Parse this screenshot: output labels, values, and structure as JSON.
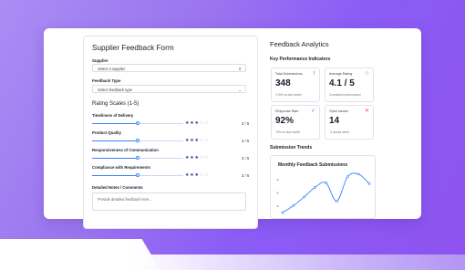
{
  "form": {
    "title": "Supplier Feedback Form",
    "supplier_label": "Supplier",
    "supplier_placeholder": "Select a supplier",
    "feedback_type_label": "Feedback Type",
    "feedback_type_placeholder": "Select feedback type",
    "ratings_title": "Rating Scales (1-5)",
    "ratings": [
      {
        "label": "Timeliness of Delivery",
        "value": 3,
        "max": 5,
        "score_text": "3 / 5"
      },
      {
        "label": "Product Quality",
        "value": 3,
        "max": 5,
        "score_text": "3 / 5"
      },
      {
        "label": "Responsiveness of Communication",
        "value": 3,
        "max": 5,
        "score_text": "3 / 5"
      },
      {
        "label": "Compliance with Requirements",
        "value": 3,
        "max": 5,
        "score_text": "3 / 5"
      }
    ],
    "notes_label": "Detailed Notes / Comments",
    "notes_placeholder": "Provide detailed feedback here..."
  },
  "analytics": {
    "title": "Feedback Analytics",
    "kpi_title": "Key Performance Indicators",
    "kpis": [
      {
        "label": "Total Submissions",
        "value": "348",
        "sub": "+15% vs last month",
        "icon": "trend-icon",
        "icon_color": "#3b82f6"
      },
      {
        "label": "Average Rating",
        "value": "4.1 / 5",
        "sub": "Consistent performance",
        "icon": "star-icon",
        "icon_color": "#22c55e"
      },
      {
        "label": "Response Rate",
        "value": "92%",
        "sub": "+5% vs last month",
        "icon": "check-icon",
        "icon_color": "#3b82f6"
      },
      {
        "label": "Open Issues",
        "value": "14",
        "sub": "-3 issues week",
        "icon": "close-icon",
        "icon_color": "#ef4444"
      }
    ],
    "trends_title": "Submission Trends"
  },
  "chart_data": {
    "type": "line",
    "title": "Monthly Feedback Submissions",
    "y_ticks": [
      "60",
      "45",
      "30"
    ],
    "x": [
      1,
      2,
      3,
      4,
      5,
      6,
      7,
      8,
      9
    ],
    "values": [
      22,
      30,
      40,
      51,
      56,
      35,
      63,
      66,
      55
    ],
    "ylim": [
      20,
      70
    ],
    "series_color": "#3b82f6"
  }
}
